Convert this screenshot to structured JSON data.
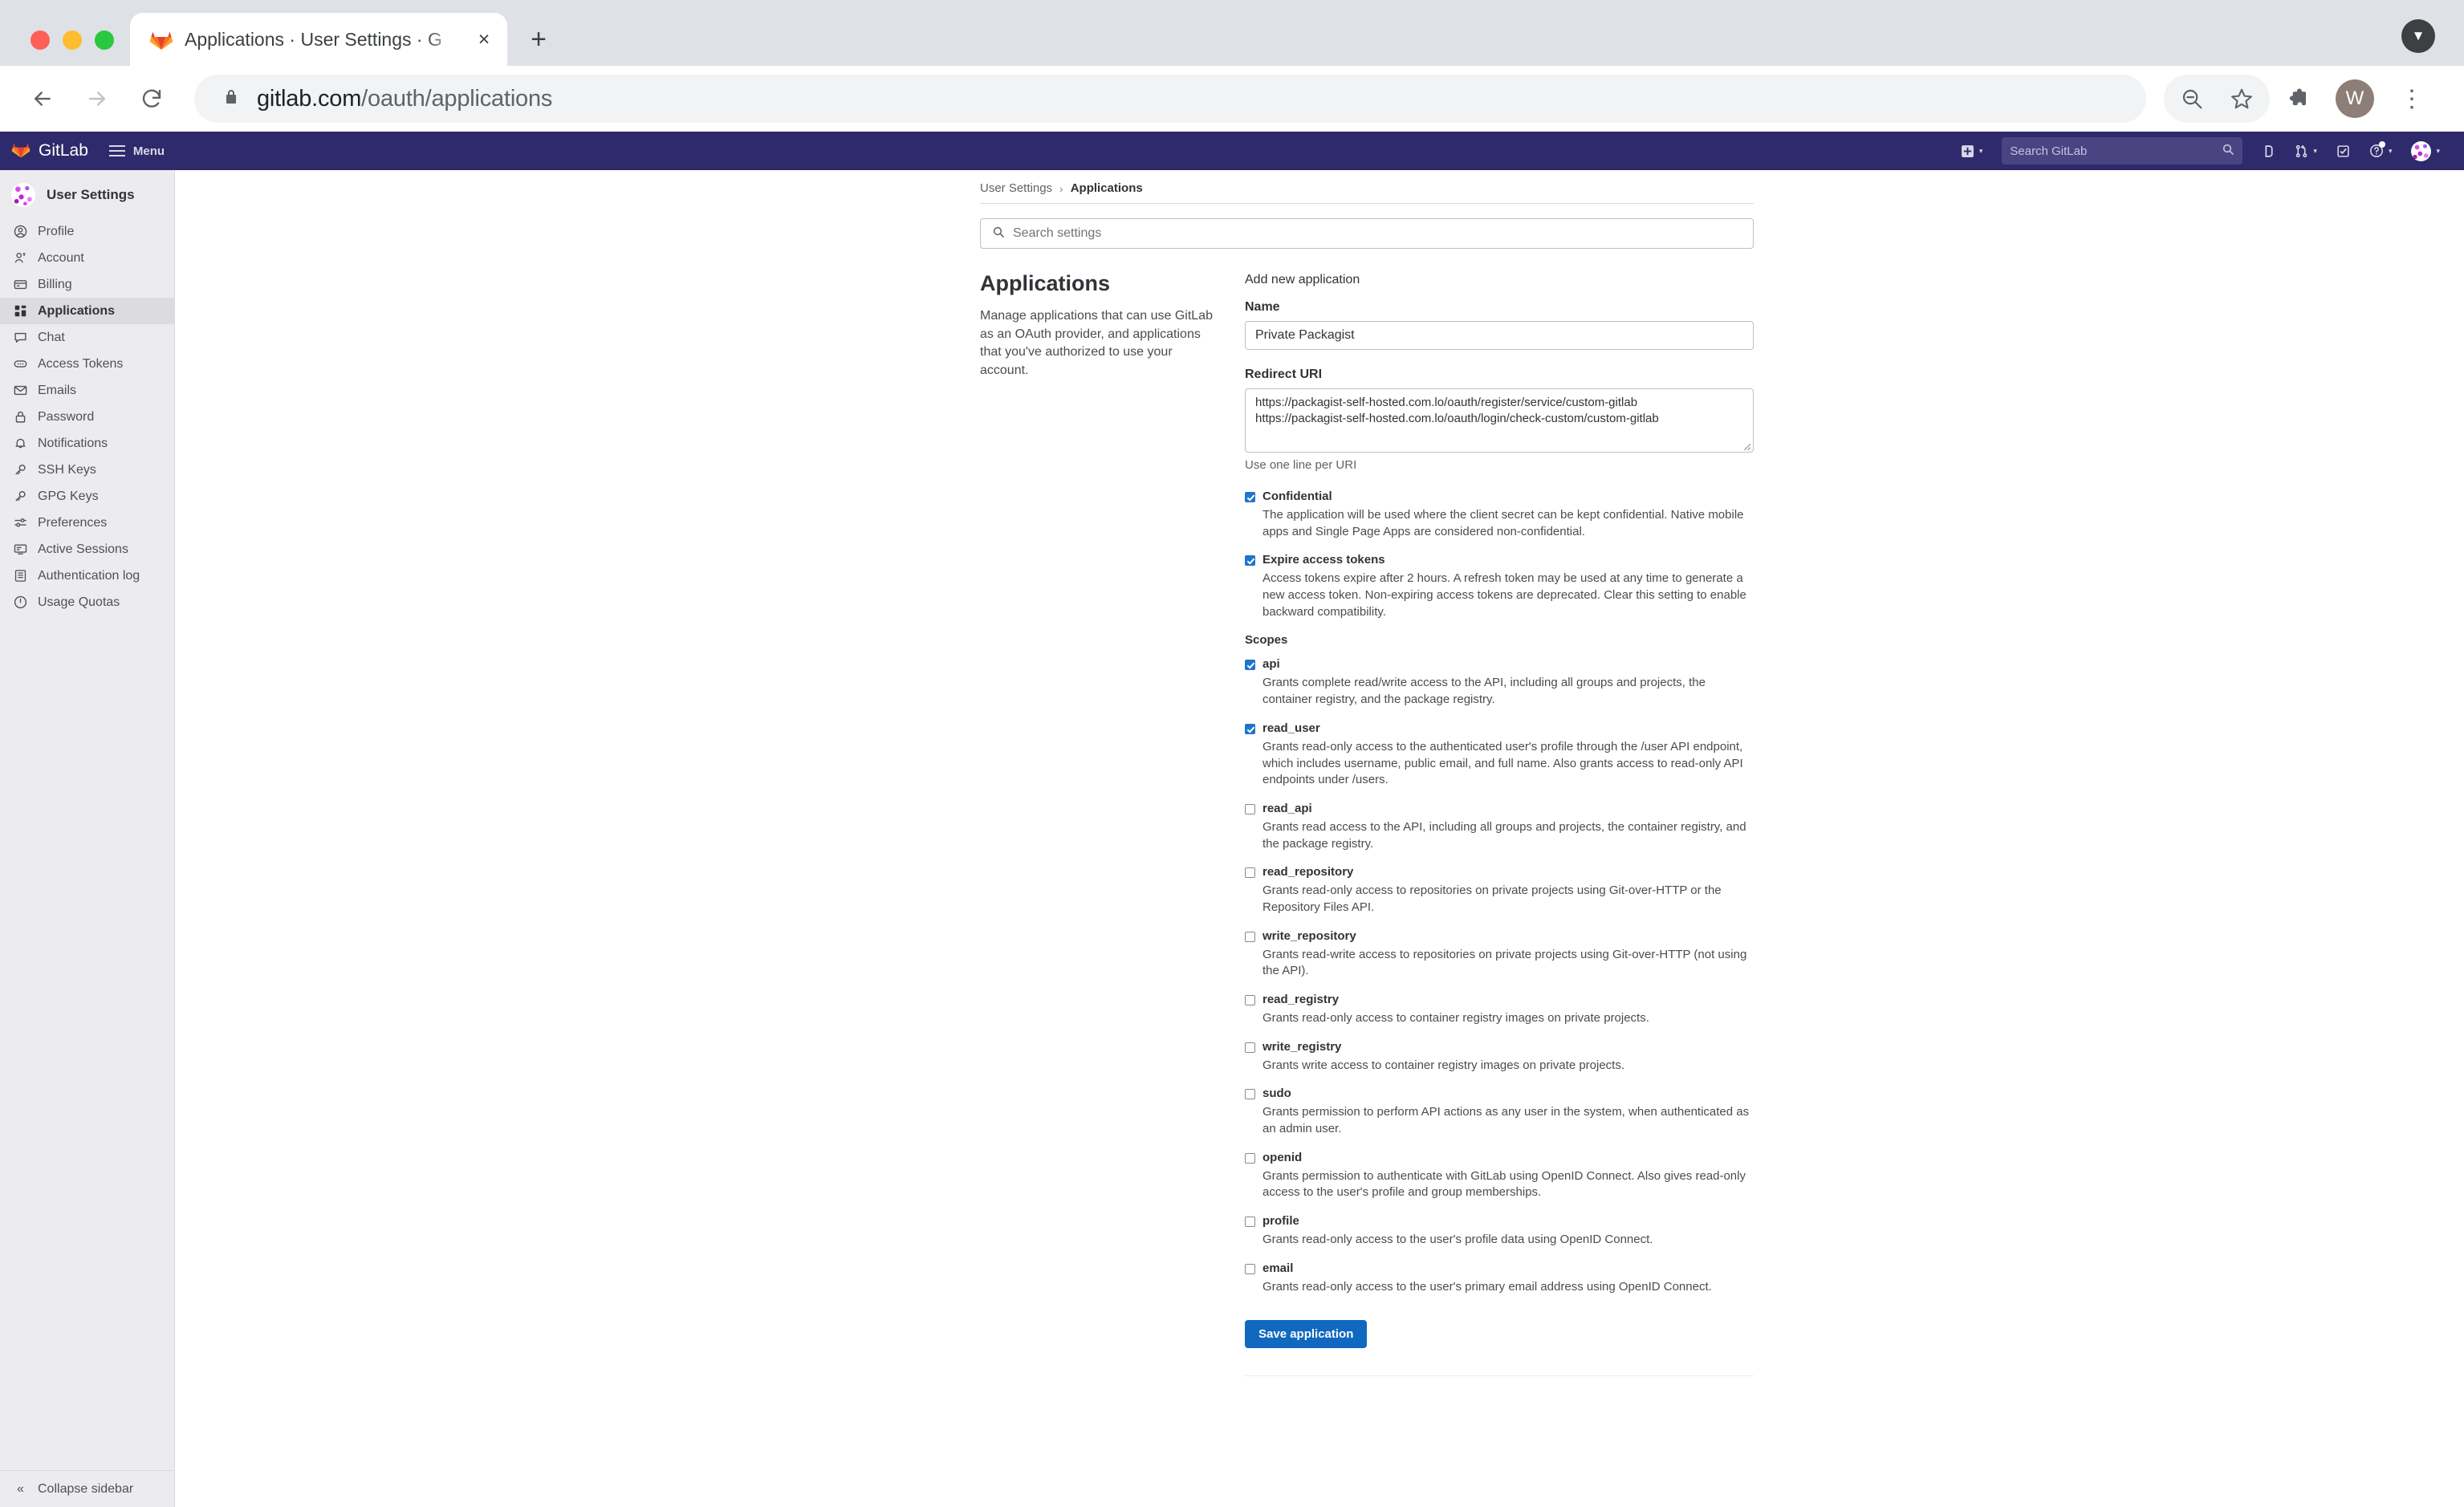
{
  "browser": {
    "tab": {
      "title": "Applications · User Settings · G",
      "favicon": "gitlab-icon",
      "close": "×"
    },
    "new_tab": "+",
    "tab_list": "▼",
    "nav": {
      "back": "←",
      "forward": "→",
      "reload": "⟳"
    },
    "omnibox": {
      "lock": "lock-icon",
      "domain": "gitlab.com",
      "path": "/oauth/applications"
    },
    "actions": {
      "zoom_out": "zoom-out-icon",
      "bookmark": "star-icon",
      "extensions": "puzzle-icon",
      "menu": "⋮"
    },
    "profile": {
      "initial": "W"
    }
  },
  "gitlab_nav": {
    "brand": "GitLab",
    "menu_label": "Menu",
    "search_placeholder": "Search GitLab",
    "items": [
      {
        "name": "new-dropdown",
        "icon": "plus-square-icon",
        "caret": "▾"
      },
      {
        "name": "issues",
        "icon": "issues-icon",
        "caret": ""
      },
      {
        "name": "merge-requests",
        "icon": "merge-request-icon",
        "caret": "▾"
      },
      {
        "name": "todos",
        "icon": "todo-check-icon",
        "caret": ""
      },
      {
        "name": "help",
        "icon": "question-circle-icon",
        "caret": "▾"
      },
      {
        "name": "user-menu",
        "icon": "user-avatar",
        "caret": "▾"
      }
    ]
  },
  "sidebar": {
    "title": "User Settings",
    "avatar": "user-avatar",
    "items": [
      {
        "label": "Profile",
        "icon": "profile-icon",
        "active": false
      },
      {
        "label": "Account",
        "icon": "account-icon",
        "active": false
      },
      {
        "label": "Billing",
        "icon": "billing-card-icon",
        "active": false
      },
      {
        "label": "Applications",
        "icon": "applications-grid-icon",
        "active": true
      },
      {
        "label": "Chat",
        "icon": "chat-bubble-icon",
        "active": false
      },
      {
        "label": "Access Tokens",
        "icon": "token-icon",
        "active": false
      },
      {
        "label": "Emails",
        "icon": "envelope-icon",
        "active": false
      },
      {
        "label": "Password",
        "icon": "lock-icon",
        "active": false
      },
      {
        "label": "Notifications",
        "icon": "bell-icon",
        "active": false
      },
      {
        "label": "SSH Keys",
        "icon": "key-icon",
        "active": false
      },
      {
        "label": "GPG Keys",
        "icon": "key-icon",
        "active": false
      },
      {
        "label": "Preferences",
        "icon": "sliders-icon",
        "active": false
      },
      {
        "label": "Active Sessions",
        "icon": "monitor-icon",
        "active": false
      },
      {
        "label": "Authentication log",
        "icon": "log-list-icon",
        "active": false
      },
      {
        "label": "Usage Quotas",
        "icon": "clock-icon",
        "active": false
      }
    ],
    "collapse_label": "Collapse sidebar",
    "collapse_icon": "«"
  },
  "breadcrumb": {
    "parent": "User Settings",
    "separator": "›",
    "current": "Applications"
  },
  "search_settings": {
    "placeholder": "Search settings",
    "icon": "search-icon"
  },
  "aside": {
    "heading": "Applications",
    "description": "Manage applications that can use GitLab as an OAuth provider, and applications that you've authorized to use your account."
  },
  "form": {
    "section_title": "Add new application",
    "name_label": "Name",
    "name_value": "Private Packagist",
    "redirect_label": "Redirect URI",
    "redirect_line1": "https://packagist-self-hosted.com.lo/oauth/register/service/custom-gitlab",
    "redirect_line2": "https://packagist-self-hosted.com.lo/oauth/login/check-custom/custom-gitlab",
    "redirect_hint": "Use one line per URI",
    "options": [
      {
        "label": "Confidential",
        "checked": true,
        "description": "The application will be used where the client secret can be kept confidential. Native mobile apps and Single Page Apps are considered non-confidential."
      },
      {
        "label": "Expire access tokens",
        "checked": true,
        "description": "Access tokens expire after 2 hours. A refresh token may be used at any time to generate a new access token. Non-expiring access tokens are deprecated. Clear this setting to enable backward compatibility."
      }
    ],
    "scopes_title": "Scopes",
    "scopes": [
      {
        "label": "api",
        "checked": true,
        "description": "Grants complete read/write access to the API, including all groups and projects, the container registry, and the package registry."
      },
      {
        "label": "read_user",
        "checked": true,
        "description": "Grants read-only access to the authenticated user's profile through the /user API endpoint, which includes username, public email, and full name. Also grants access to read-only API endpoints under /users."
      },
      {
        "label": "read_api",
        "checked": false,
        "description": "Grants read access to the API, including all groups and projects, the container registry, and the package registry."
      },
      {
        "label": "read_repository",
        "checked": false,
        "description": "Grants read-only access to repositories on private projects using Git-over-HTTP or the Repository Files API."
      },
      {
        "label": "write_repository",
        "checked": false,
        "description": "Grants read-write access to repositories on private projects using Git-over-HTTP (not using the API)."
      },
      {
        "label": "read_registry",
        "checked": false,
        "description": "Grants read-only access to container registry images on private projects."
      },
      {
        "label": "write_registry",
        "checked": false,
        "description": "Grants write access to container registry images on private projects."
      },
      {
        "label": "sudo",
        "checked": false,
        "description": "Grants permission to perform API actions as any user in the system, when authenticated as an admin user."
      },
      {
        "label": "openid",
        "checked": false,
        "description": "Grants permission to authenticate with GitLab using OpenID Connect. Also gives read-only access to the user's profile and group memberships."
      },
      {
        "label": "profile",
        "checked": false,
        "description": "Grants read-only access to the user's profile data using OpenID Connect."
      },
      {
        "label": "email",
        "checked": false,
        "description": "Grants read-only access to the user's primary email address using OpenID Connect."
      }
    ],
    "save_label": "Save application"
  },
  "colors": {
    "gitlab_navy": "#2f2a6b",
    "gitlab_orange": "#fc6d26",
    "primary_button": "#1068bf",
    "checkbox_blue": "#1f75cb",
    "sidebar_bg": "#ececef"
  }
}
